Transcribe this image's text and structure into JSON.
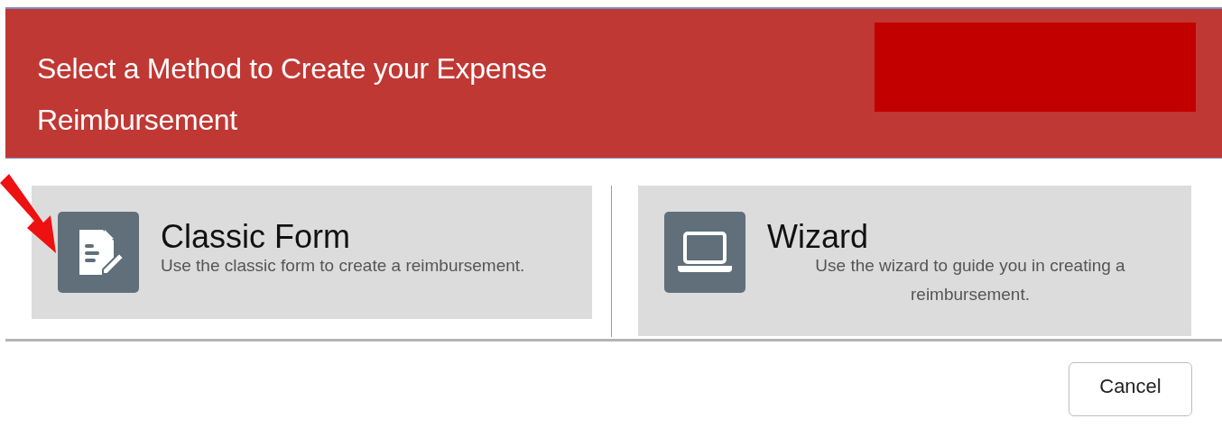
{
  "dialog": {
    "title": "Select a Method to Create your Expense Reimbursement",
    "options": [
      {
        "kind": "form",
        "title": "Classic Form",
        "description": "Use the classic form to create a reimbursement.",
        "pointed": true
      },
      {
        "kind": "laptop",
        "title": "Wizard",
        "description": "Use the wizard to guide you in creating a reimbursement.",
        "pointed": false
      }
    ],
    "buttons": [
      "Cancel"
    ]
  }
}
